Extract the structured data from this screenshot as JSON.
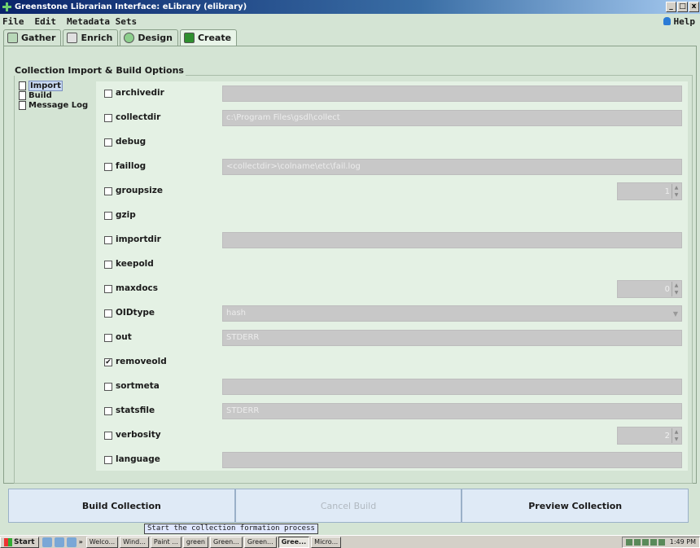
{
  "window": {
    "title": "Greenstone Librarian Interface: eLibrary (elibrary)",
    "min": "_",
    "max": "□",
    "close": "x"
  },
  "menu": {
    "file": "File",
    "edit": "Edit",
    "metadata_sets": "Metadata Sets",
    "help": "Help"
  },
  "tabs": [
    {
      "label": "Gather",
      "icon": "gather-icon"
    },
    {
      "label": "Enrich",
      "icon": "enrich-icon"
    },
    {
      "label": "Design",
      "icon": "design-icon"
    },
    {
      "label": "Create",
      "icon": "create-icon"
    }
  ],
  "panel": {
    "title": "Collection Import & Build Options"
  },
  "tree": [
    {
      "label": "Import",
      "selected": true
    },
    {
      "label": "Build"
    },
    {
      "label": "Message Log"
    }
  ],
  "options": [
    {
      "name": "archivedir",
      "checked": false,
      "value": ""
    },
    {
      "name": "collectdir",
      "checked": false,
      "value": "c:\\Program Files\\gsdl\\collect"
    },
    {
      "name": "debug",
      "checked": false
    },
    {
      "name": "faillog",
      "checked": false,
      "value": "<collectdir>\\colname\\etc\\fail.log"
    },
    {
      "name": "groupsize",
      "checked": false,
      "spin": "1"
    },
    {
      "name": "gzip",
      "checked": false
    },
    {
      "name": "importdir",
      "checked": false,
      "value": ""
    },
    {
      "name": "keepold",
      "checked": false
    },
    {
      "name": "maxdocs",
      "checked": false,
      "spin": "0"
    },
    {
      "name": "OIDtype",
      "checked": false,
      "value": "hash"
    },
    {
      "name": "out",
      "checked": false,
      "value": "STDERR"
    },
    {
      "name": "removeold",
      "checked": true
    },
    {
      "name": "sortmeta",
      "checked": false,
      "value": ""
    },
    {
      "name": "statsfile",
      "checked": false,
      "value": "STDERR"
    },
    {
      "name": "verbosity",
      "checked": false,
      "spin": "2"
    },
    {
      "name": "language",
      "checked": false,
      "value": ""
    }
  ],
  "buttons": {
    "build": "Build Collection",
    "cancel": "Cancel Build",
    "preview": "Preview Collection"
  },
  "tooltip": "Start the collection formation process",
  "taskbar": {
    "start": "Start",
    "more": "»",
    "tasks": [
      "Welco...",
      "Wind...",
      "Paint ...",
      "green",
      "Green...",
      "Green...",
      "Gree...",
      "Micro..."
    ],
    "active_task": 6,
    "clock": "1:49 PM"
  }
}
